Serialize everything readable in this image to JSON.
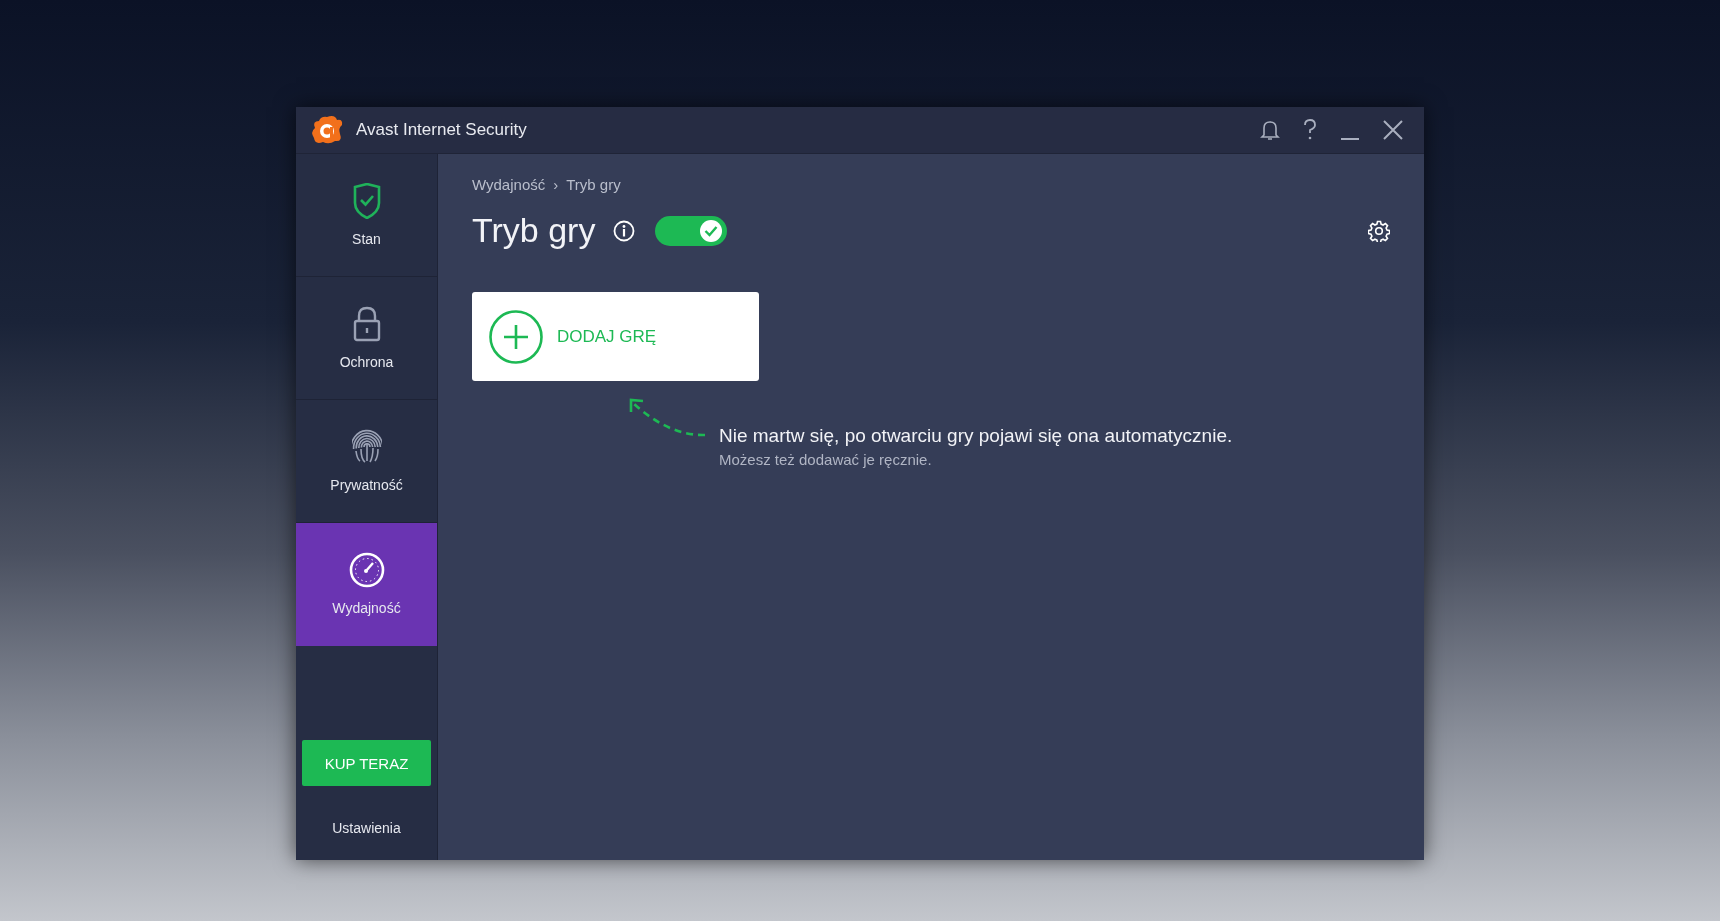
{
  "window": {
    "title": "Avast Internet Security"
  },
  "sidebar": {
    "items": [
      {
        "label": "Stan",
        "kind": "shield",
        "selected": false
      },
      {
        "label": "Ochrona",
        "kind": "lock",
        "selected": false
      },
      {
        "label": "Prywatność",
        "kind": "fingerprint",
        "selected": false
      },
      {
        "label": "Wydajność",
        "kind": "gauge",
        "selected": true
      }
    ],
    "buy_button": "KUP TERAZ",
    "settings_link": "Ustawienia"
  },
  "breadcrumb": {
    "parent": "Wydajność",
    "separator": "›",
    "current": "Tryb gry"
  },
  "header": {
    "title": "Tryb gry",
    "toggle": {
      "on": true
    }
  },
  "add_game": {
    "label": "DODAJ GRĘ"
  },
  "hint": {
    "text": "Nie martw się, po otwarciu gry pojawi się ona automatycznie.",
    "subtext": "Możesz też dodawać je ręcznie."
  }
}
